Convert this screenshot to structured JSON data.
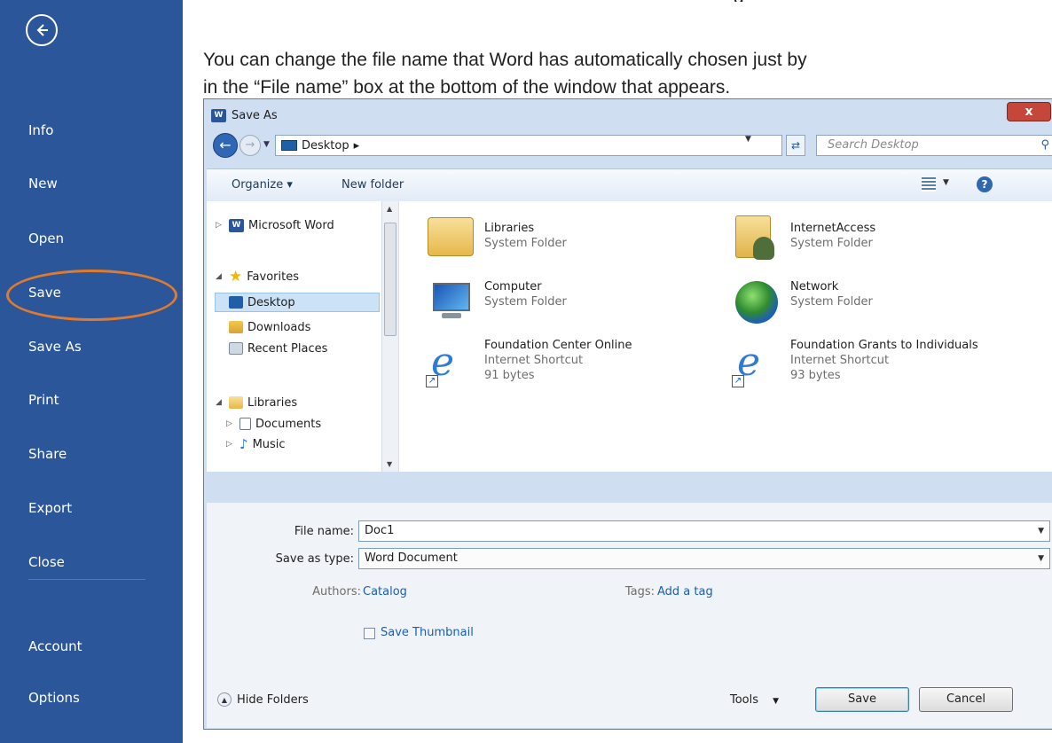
{
  "backstage": {
    "items": [
      {
        "label": "Info"
      },
      {
        "label": "New"
      },
      {
        "label": "Open"
      },
      {
        "label": "Save"
      },
      {
        "label": "Save As"
      },
      {
        "label": "Print"
      },
      {
        "label": "Share"
      },
      {
        "label": "Export"
      },
      {
        "label": "Close"
      },
      {
        "label": "Account"
      },
      {
        "label": "Options"
      }
    ],
    "highlight_color": "#e07a2e",
    "background_color": "#2b579a"
  },
  "instruction": {
    "top_fragment": "g",
    "line1": "You can change the file name that Word has automatically chosen just by",
    "line2": "in the “File name” box at the bottom of the window that appears."
  },
  "dialog": {
    "title": "Save As",
    "close_label": "x",
    "address": {
      "location": "Desktop",
      "separator": "▸"
    },
    "search_placeholder": "Search Desktop",
    "toolbar": {
      "organize": "Organize ▾",
      "new_folder": "New folder"
    },
    "nav_tree": [
      {
        "label": "Microsoft Word"
      },
      {
        "label": "Favorites"
      },
      {
        "label": "Desktop"
      },
      {
        "label": "Downloads"
      },
      {
        "label": "Recent Places"
      },
      {
        "label": "Libraries"
      },
      {
        "label": "Documents"
      },
      {
        "label": "Music"
      }
    ],
    "files": [
      {
        "name": "Libraries",
        "type": "System Folder",
        "size": ""
      },
      {
        "name": "InternetAccess",
        "type": "System Folder",
        "size": ""
      },
      {
        "name": "Computer",
        "type": "System Folder",
        "size": ""
      },
      {
        "name": "Network",
        "type": "System Folder",
        "size": ""
      },
      {
        "name": "Foundation Center Online",
        "type": "Internet Shortcut",
        "size": "91 bytes"
      },
      {
        "name": "Foundation Grants to Individuals",
        "type": "Internet Shortcut",
        "size": "93 bytes"
      }
    ],
    "form": {
      "file_name_label": "File name:",
      "file_name_value": "Doc1",
      "save_type_label": "Save as type:",
      "save_type_value": "Word Document",
      "authors_label": "Authors:",
      "authors_value": "Catalog",
      "tags_label": "Tags:",
      "tags_value": "Add a tag",
      "thumbnail_label": "Save Thumbnail",
      "hide_folders": "Hide Folders",
      "tools": "Tools",
      "save": "Save",
      "cancel": "Cancel"
    }
  }
}
